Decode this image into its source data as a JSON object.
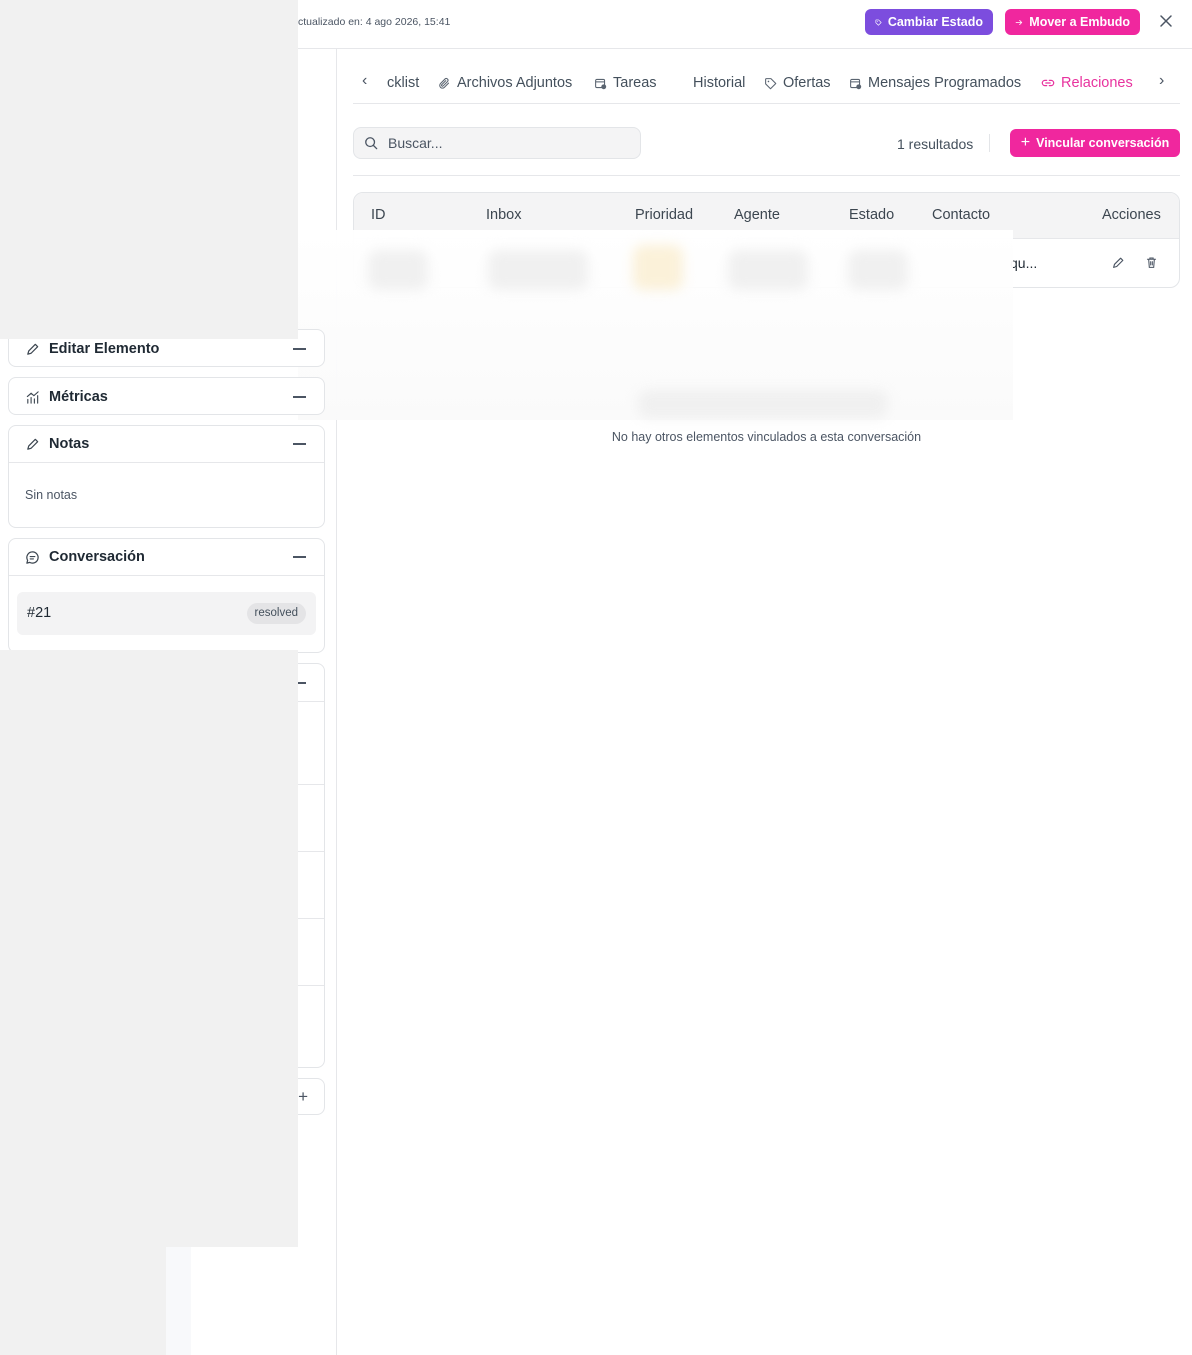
{
  "header": {
    "updated_text": "ctualizado en: 4 ago 2026, 15:41",
    "change_status_label": "Cambiar Estado",
    "move_funnel_label": "Mover a Embudo"
  },
  "tabs": {
    "items": [
      {
        "label": "cklist"
      },
      {
        "label": "Archivos Adjuntos"
      },
      {
        "label": "Tareas"
      },
      {
        "label": "Historial"
      },
      {
        "label": "Ofertas"
      },
      {
        "label": "Mensajes Programados"
      },
      {
        "label": "Relaciones",
        "active": true
      }
    ]
  },
  "search": {
    "placeholder": "Buscar...",
    "value": ""
  },
  "results_text": "1 resultados",
  "link_button_label": "Vincular conversación",
  "table": {
    "columns": [
      "ID",
      "Inbox",
      "Prioridad",
      "Agente",
      "Estado",
      "Contacto",
      "Acciones"
    ],
    "row": {
      "contact_visible": "qu..."
    }
  },
  "empty_text": "No hay otros elementos vinculados a esta conversación",
  "sidebar": {
    "edit_panel_title": "Editar Elemento",
    "metrics_panel_title": "Métricas",
    "notes_panel": {
      "title": "Notas",
      "empty": "Sin notas"
    },
    "conversation_panel": {
      "title": "Conversación",
      "id": "#21",
      "status": "resolved"
    }
  },
  "colors": {
    "accent_pink": "#f0279e",
    "accent_purple": "#7c4dde"
  }
}
